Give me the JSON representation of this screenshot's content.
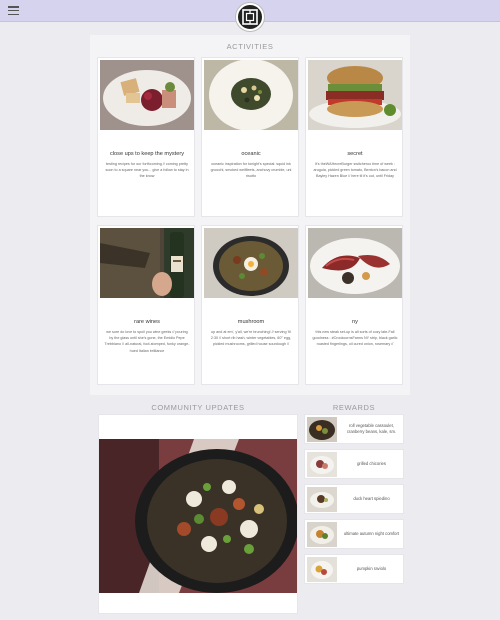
{
  "header": {
    "menu_icon": "hamburger-menu-icon",
    "logo_icon": "brand-logo-icon",
    "accent": "#d6d3ee"
  },
  "activities": {
    "title": "ACTIVITIES",
    "cards": [
      {
        "title": "close ups to keep the mystery",
        "desc": "testing recipes for our forthcoming // coming pretty soon to a square near you... give a follow to stay in the know"
      },
      {
        "title": "oceanic",
        "desc": "oceanic inspiration for tonight's special: squid ink gnocchi, smoked wellfleets, anchovy crumble, uni risotto"
      },
      {
        "title": "secret",
        "desc": "It's theWAHecreBurger switcheroo time of week : arugula, pickled green tomato, Benton's bacon and Bayley Hazen Blue // here til it's out, until Friday"
      },
      {
        "title": "rare wines",
        "desc": "we sure do love to spoil you wine geeks // pouring by the glass until she's gone, the Emidio Pepe Trebbiano // all-natural, foot-stomped, funky orange-hued Italian brilliance"
      },
      {
        "title": "mushroom",
        "desc": "up and at em', y'all, we're brunching! // serving 'til 2:30 // short rib hash, winter vegetables, 60° egg, pickled mushrooms, grilled house sourdough //"
      },
      {
        "title": "ny",
        "desc": "this new steak set-up is all sorts of cozy late-Fall goodness : #CrookcornsFarms NY strip, black garlic roasted fingerlings, oil cured onion, rosemary //"
      }
    ]
  },
  "community": {
    "title": "COMMUNITY UPDATES"
  },
  "rewards": {
    "title": "REWARDS",
    "items": [
      {
        "label": "roll vegetable cassoulet, cranberry beans, kale, sm."
      },
      {
        "label": "grilled chicories"
      },
      {
        "label": "duck heart spiedino"
      },
      {
        "label": "ultimate autumn night comfort"
      },
      {
        "label": "pumpkin raviolo"
      }
    ]
  }
}
